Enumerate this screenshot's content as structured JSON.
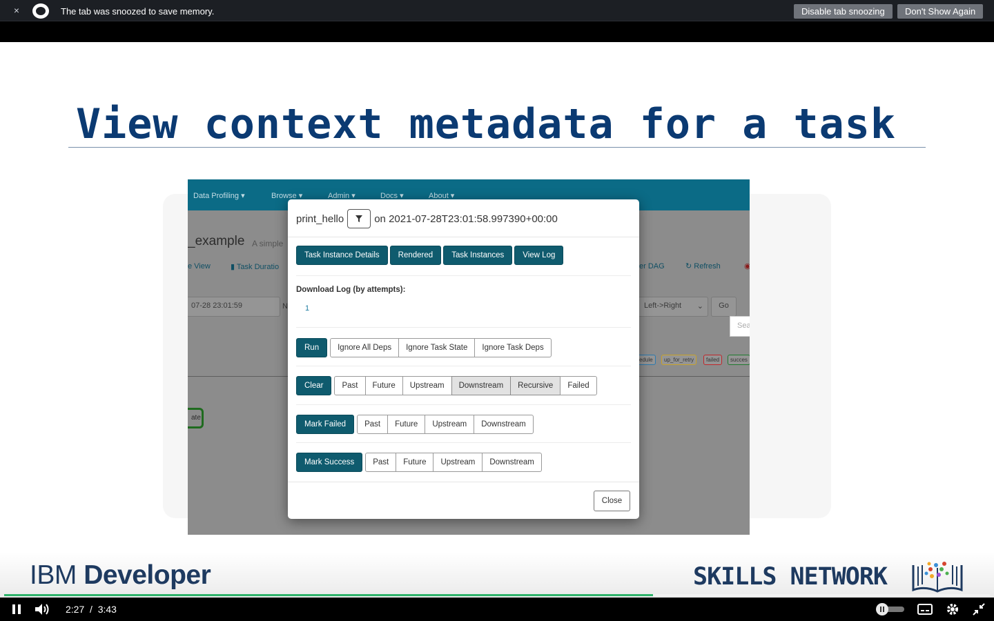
{
  "snooze_bar": {
    "message": "The tab was snoozed to save memory.",
    "disable_button": "Disable tab snoozing",
    "dont_show_button": "Don't Show Again",
    "close_symbol": "×"
  },
  "slide": {
    "title": "View context metadata for a task"
  },
  "airflow_bg": {
    "nav_items": [
      "Data Profiling ▾",
      "Browse ▾",
      "Admin ▾",
      "Docs ▾",
      "About ▾"
    ],
    "dag_title": "_example",
    "dag_subtitle": "A simple",
    "tab_view": "e View",
    "tab_task_duration": "Task Duratio",
    "tab_er_dag": "er DAG",
    "refresh": "Refresh",
    "date_field": "07-28 23:01:59",
    "date_suffix": "N",
    "layout_select": "Left->Right",
    "go_button": "Go",
    "search_placeholder": "Sea",
    "legend": [
      "edule",
      "up_for_retry",
      "failed",
      "succes"
    ],
    "node_label": "ate"
  },
  "modal": {
    "task_id": "print_hello",
    "run_info": "on 2021-07-28T23:01:58.997390+00:00",
    "tabs": [
      "Task Instance Details",
      "Rendered",
      "Task Instances",
      "View Log"
    ],
    "download_label": "Download Log (by attempts):",
    "attempts": [
      "1"
    ],
    "run_button": "Run",
    "run_options": [
      "Ignore All Deps",
      "Ignore Task State",
      "Ignore Task Deps"
    ],
    "clear_button": "Clear",
    "clear_options": [
      "Past",
      "Future",
      "Upstream",
      "Downstream",
      "Recursive",
      "Failed"
    ],
    "mark_failed_button": "Mark Failed",
    "mark_failed_options": [
      "Past",
      "Future",
      "Upstream",
      "Downstream"
    ],
    "mark_success_button": "Mark Success",
    "mark_success_options": [
      "Past",
      "Future",
      "Upstream",
      "Downstream"
    ],
    "close_button": "Close"
  },
  "branding": {
    "ibm_prefix": "IBM",
    "ibm_name": "Developer",
    "skills": "SKILLS NETWORK"
  },
  "player": {
    "current_time": "2:27",
    "separator": "/",
    "total_time": "3:43",
    "progress": 0.658
  },
  "colors": {
    "slide_title": "#0b3a72",
    "airflow_primary": "#0f5b6e",
    "progress": "#2fb36b"
  }
}
